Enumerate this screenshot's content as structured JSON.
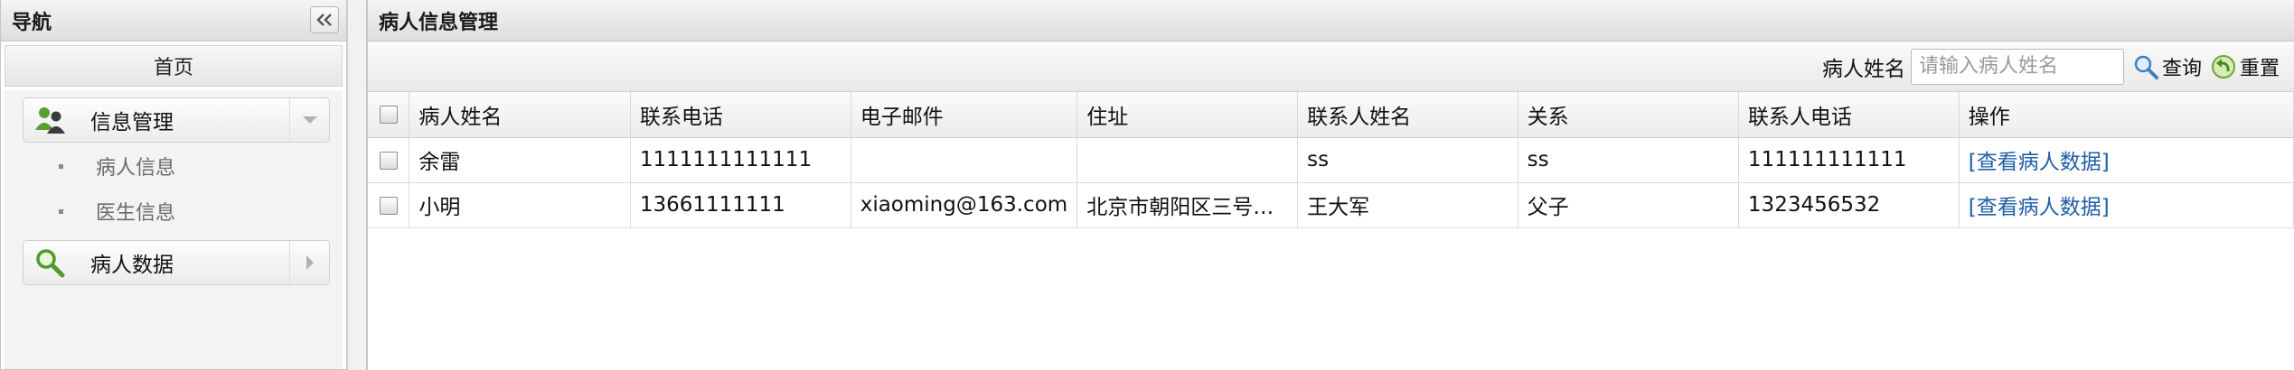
{
  "nav": {
    "title": "导航",
    "home": "首页",
    "groups": [
      {
        "label": "信息管理",
        "icon": "users-icon",
        "expanded": true
      },
      {
        "label": "病人数据",
        "icon": "search-icon",
        "expanded": false
      }
    ],
    "sub_items": [
      {
        "label": "病人信息"
      },
      {
        "label": "医生信息"
      }
    ]
  },
  "main": {
    "title": "病人信息管理",
    "search": {
      "label": "病人姓名",
      "placeholder": "请输入病人姓名",
      "value": ""
    },
    "query_label": "查询",
    "reset_label": "重置"
  },
  "table": {
    "columns": [
      "病人姓名",
      "联系电话",
      "电子邮件",
      "住址",
      "联系人姓名",
      "关系",
      "联系人电话",
      "操作"
    ],
    "rows": [
      {
        "name": "余雷",
        "phone": "1111111111111",
        "email": "",
        "address": "",
        "contact": "ss",
        "relation": "ss",
        "contact_phone": "111111111111",
        "action": "[查看病人数据]",
        "checked": false
      },
      {
        "name": "小明",
        "phone": "13661111111",
        "email": "xiaoming@163.com",
        "address": "北京市朝阳区三号…",
        "contact": "王大军",
        "relation": "父子",
        "contact_phone": "1323456532",
        "action": "[查看病人数据]",
        "checked": false
      }
    ]
  },
  "colors": {
    "link": "#1f5fa8",
    "header_bg": "#e6e6e6",
    "border": "#c6c6c6"
  }
}
